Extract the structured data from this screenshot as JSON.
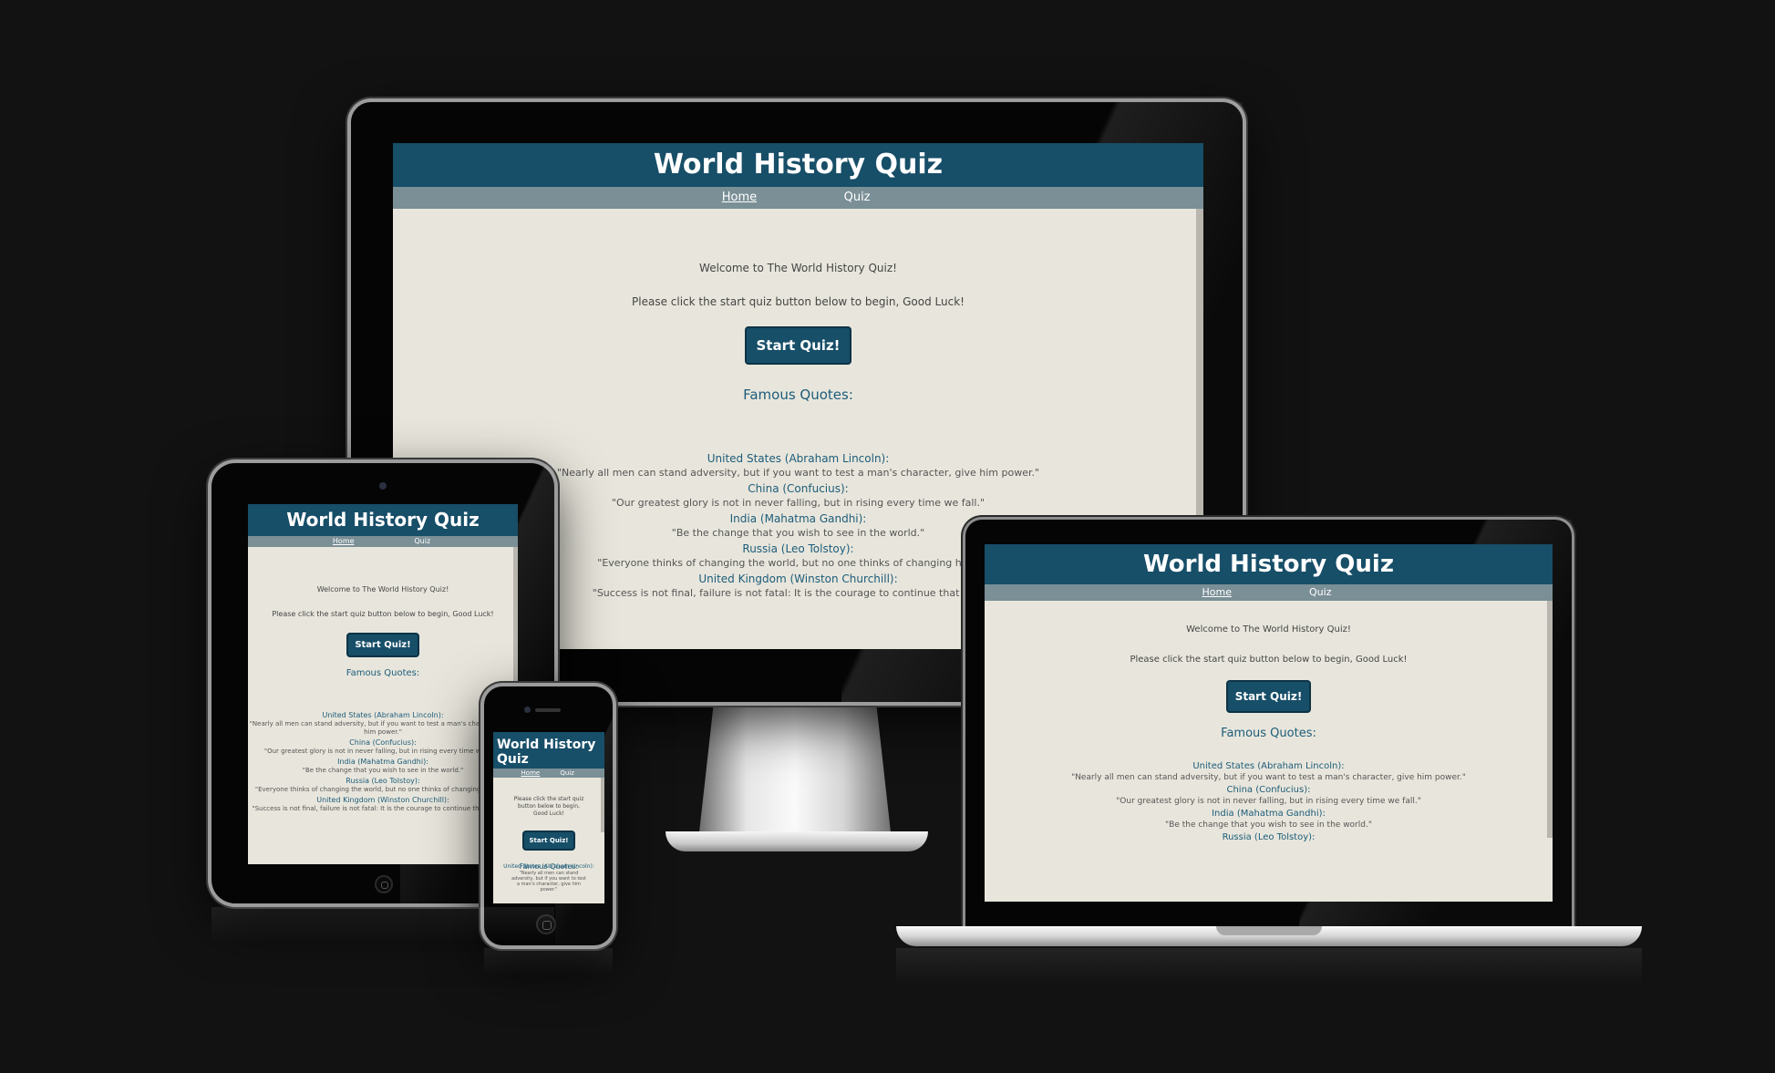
{
  "site": {
    "title": "World History Quiz",
    "nav": {
      "home": "Home",
      "quiz": "Quiz"
    },
    "welcome": "Welcome to The World History Quiz!",
    "instructions": "Please click the start quiz button below to begin, Good Luck!",
    "start_button": "Start Quiz!",
    "quotes_title": "Famous Quotes:",
    "quotes": [
      {
        "country": "United States (Abraham Lincoln):",
        "text": "\"Nearly all men can stand adversity, but if you want to test a man's character, give him power.\""
      },
      {
        "country": "China (Confucius):",
        "text": "\"Our greatest glory is not in never falling, but in rising every time we fall.\""
      },
      {
        "country": "India (Mahatma Gandhi):",
        "text": "\"Be the change that you wish to see in the world.\""
      },
      {
        "country": "Russia (Leo Tolstoy):",
        "text": "\"Everyone thinks of changing the world, but no one thinks of changing himself.\""
      },
      {
        "country": "United Kingdom (Winston Churchill):",
        "text": "\"Success is not final, failure is not fatal: It is the courage to continue that counts.\""
      }
    ]
  },
  "colors": {
    "background": "#121212",
    "header": "#174e68",
    "nav": "#7a8f96",
    "page": "#e8e6dc",
    "accent": "#1d5c7a"
  },
  "devices": [
    "desktop-monitor",
    "tablet",
    "phone",
    "laptop"
  ]
}
